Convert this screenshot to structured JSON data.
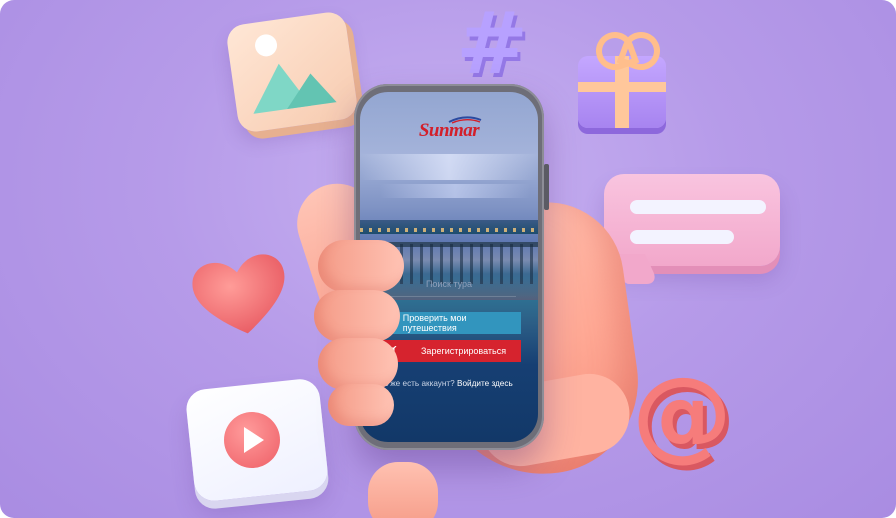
{
  "app": {
    "brand": "Sunmar"
  },
  "search": {
    "placeholder": "Поиск тура"
  },
  "buttons": {
    "check_trips_label": "Проверить мои путешествия",
    "register_label": "Зарегистрироваться"
  },
  "login": {
    "prompt": "Уже есть аккаунт?",
    "link_label": "Войдите здесь"
  },
  "colors": {
    "accent_blue": "#3295be",
    "accent_red": "#d6232e",
    "background": "#b69be9"
  },
  "icons": {
    "check_trips": "chevron-up-icon",
    "register": "edit-checkbox-icon"
  }
}
